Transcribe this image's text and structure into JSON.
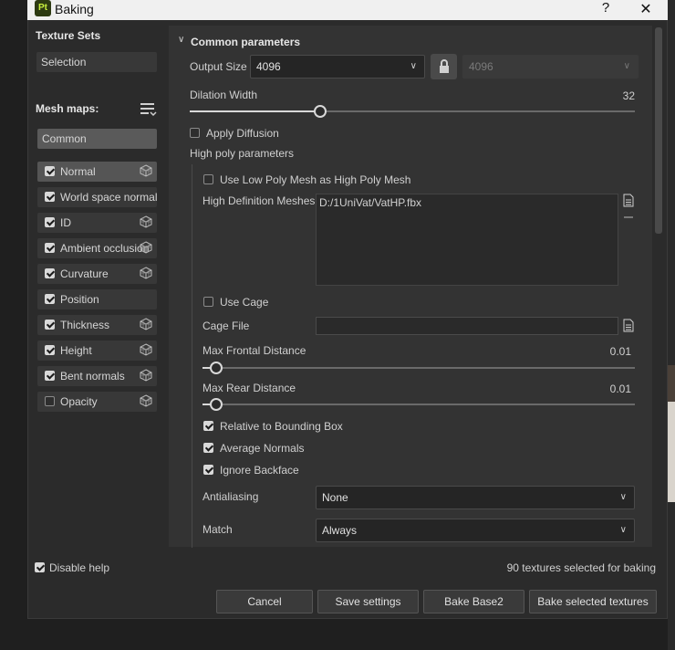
{
  "window": {
    "title": "Baking",
    "logo_text": "Pt",
    "help_label": "?",
    "close_label": "✕"
  },
  "left": {
    "texture_sets_title": "Texture Sets",
    "texture_set_value": "Selection",
    "mesh_maps_title": "Mesh maps:",
    "common_label": "Common",
    "maps": [
      {
        "label": "Normal",
        "checked": true,
        "icon": "cube-icon"
      },
      {
        "label": "World space normal",
        "checked": true
      },
      {
        "label": "ID",
        "checked": true,
        "icon": "cube-icon"
      },
      {
        "label": "Ambient occlusion",
        "checked": true,
        "icon": "cube-icon"
      },
      {
        "label": "Curvature",
        "checked": true,
        "icon": "cube-icon"
      },
      {
        "label": "Position",
        "checked": true
      },
      {
        "label": "Thickness",
        "checked": true,
        "icon": "cube-icon"
      },
      {
        "label": "Height",
        "checked": true,
        "icon": "cube-icon"
      },
      {
        "label": "Bent normals",
        "checked": true,
        "icon": "cube-icon"
      },
      {
        "label": "Opacity",
        "checked": false,
        "icon": "cube-icon"
      }
    ]
  },
  "params": {
    "section_title": "Common parameters",
    "output_size_label": "Output Size",
    "output_size_value": "4096",
    "output_size_linked_value": "4096",
    "dilation_label": "Dilation Width",
    "dilation_value": "32",
    "dilation_fraction": 0.29,
    "apply_diffusion_label": "Apply Diffusion",
    "apply_diffusion_checked": false,
    "high_poly_title": "High poly parameters",
    "use_low_poly_label": "Use Low Poly Mesh as High Poly Mesh",
    "use_low_poly_checked": false,
    "hd_meshes_label": "High Definition Meshes",
    "hd_meshes_value": "D:/1UniVat/VatHP.fbx",
    "use_cage_label": "Use Cage",
    "use_cage_checked": false,
    "cage_file_label": "Cage File",
    "cage_file_value": "",
    "max_frontal_label": "Max Frontal Distance",
    "max_frontal_value": "0.01",
    "max_rear_label": "Max Rear Distance",
    "max_rear_value": "0.01",
    "relative_bbox_label": "Relative to Bounding Box",
    "average_normals_label": "Average Normals",
    "ignore_backface_label": "Ignore Backface",
    "antialiasing_label": "Antialiasing",
    "antialiasing_value": "None",
    "match_label": "Match",
    "match_value": "Always"
  },
  "footer": {
    "disable_help_label": "Disable help",
    "disable_help_checked": true,
    "status_text": "90 textures selected for baking",
    "cancel_label": "Cancel",
    "save_settings_label": "Save settings",
    "bake_base_label": "Bake Base2",
    "bake_selected_label": "Bake selected textures"
  }
}
